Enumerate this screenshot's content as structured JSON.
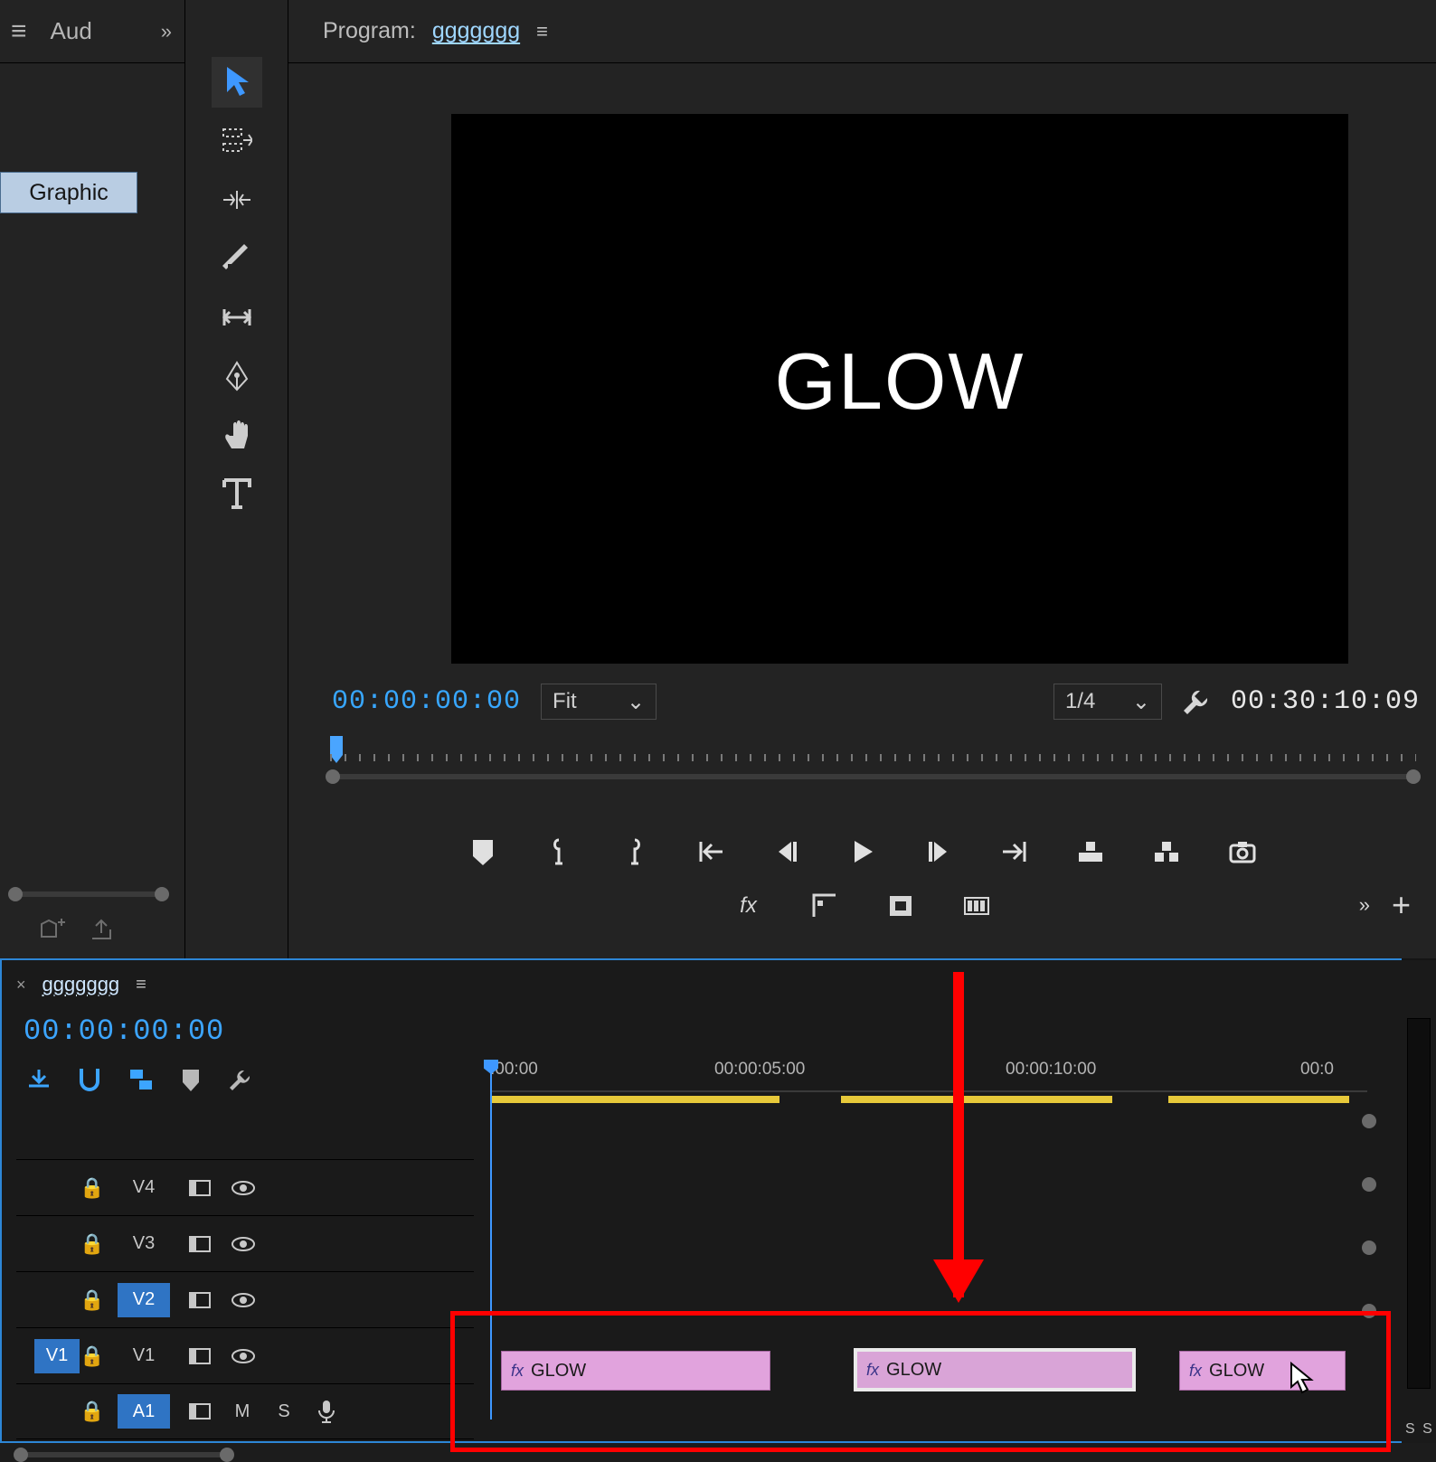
{
  "left": {
    "aud_label": "Aud",
    "graphic_tab": "Graphic"
  },
  "program": {
    "label": "Program:",
    "sequence_name": "ggggggg",
    "viewer_text": "GLOW",
    "timecode_in": "00:00:00:00",
    "timecode_out": "00:30:10:09",
    "fit_label": "Fit",
    "resolution_label": "1/4"
  },
  "timeline": {
    "sequence_name": "ggggggg",
    "timecode": "00:00:00:00",
    "ruler_marks": [
      {
        "label": ":00:00",
        "pos": 0
      },
      {
        "label": "00:00:05:00",
        "pos": 248
      },
      {
        "label": "00:00:10:00",
        "pos": 570
      },
      {
        "label": "00:0",
        "pos": 896
      }
    ],
    "tracks": [
      {
        "name": "V4",
        "type": "video",
        "hilite": false,
        "src_label": ""
      },
      {
        "name": "V3",
        "type": "video",
        "hilite": false,
        "src_label": ""
      },
      {
        "name": "V2",
        "type": "video",
        "hilite": true,
        "src_label": ""
      },
      {
        "name": "V1",
        "type": "video",
        "hilite": false,
        "src_label": "V1"
      },
      {
        "name": "A1",
        "type": "audio",
        "hilite": true,
        "src_label": ""
      }
    ],
    "clips": [
      {
        "label": "GLOW",
        "class": "clip1",
        "selected": false
      },
      {
        "label": "GLOW",
        "class": "clip2",
        "selected": true
      },
      {
        "label": "GLOW",
        "class": "clip3",
        "selected": false
      }
    ],
    "meter_label": "S S"
  }
}
